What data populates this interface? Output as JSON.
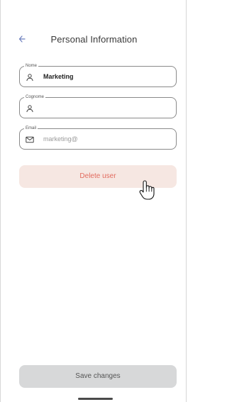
{
  "header": {
    "title": "Personal Information",
    "back_icon": "arrow-left-icon"
  },
  "form": {
    "name": {
      "label": "Nome",
      "value": "Marketing",
      "icon": "user-icon"
    },
    "surname": {
      "label": "Cognome",
      "value": "",
      "icon": "user-icon"
    },
    "email": {
      "label": "Email",
      "value": "marketing@",
      "icon": "mail-icon"
    }
  },
  "actions": {
    "delete_label": "Delete user",
    "save_label": "Save changes"
  },
  "colors": {
    "accent": "#6b7dbd",
    "danger_text": "#e26b5f",
    "danger_bg": "#f6e7e2",
    "disabled_bg": "#d7d8d9"
  }
}
